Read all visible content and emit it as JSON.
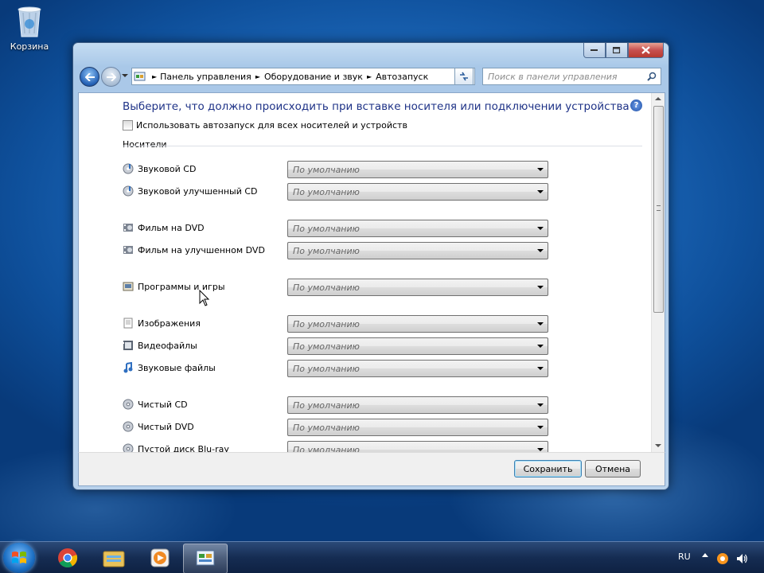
{
  "desktop": {
    "recycle_bin_label": "Корзина"
  },
  "window": {
    "breadcrumb": [
      "Панель управления",
      "Оборудование и звук",
      "Автозапуск"
    ],
    "search_placeholder": "Поиск в панели управления",
    "heading": "Выберите, что должно происходить при вставке носителя или подключении устройства",
    "use_autoplay_label": "Использовать автозапуск для всех носителей и устройств",
    "use_autoplay_checked": false,
    "media_group_label": "Носители",
    "rows": [
      {
        "label": "Звуковой CD",
        "value": "По умолчанию",
        "icon": "audio-cd-icon"
      },
      {
        "label": "Звуковой улучшенный CD",
        "value": "По умолчанию",
        "icon": "enhanced-audio-cd-icon"
      },
      {
        "label": "Фильм на DVD",
        "value": "По умолчанию",
        "icon": "dvd-movie-icon"
      },
      {
        "label": "Фильм на улучшенном DVD",
        "value": "По умолчанию",
        "icon": "enhanced-dvd-movie-icon"
      },
      {
        "label": "Программы и игры",
        "value": "По умолчанию",
        "icon": "software-games-icon"
      },
      {
        "label": "Изображения",
        "value": "По умолчанию",
        "icon": "pictures-icon"
      },
      {
        "label": "Видеофайлы",
        "value": "По умолчанию",
        "icon": "video-files-icon"
      },
      {
        "label": "Звуковые файлы",
        "value": "По умолчанию",
        "icon": "audio-files-icon"
      },
      {
        "label": "Чистый CD",
        "value": "По умолчанию",
        "icon": "blank-cd-icon"
      },
      {
        "label": "Чистый DVD",
        "value": "По умолчанию",
        "icon": "blank-dvd-icon"
      },
      {
        "label": "Пустой диск Blu-ray",
        "value": "По умолчанию",
        "icon": "blank-bluray-icon"
      }
    ],
    "save_label": "Сохранить",
    "cancel_label": "Отмена"
  },
  "taskbar": {
    "language": "RU"
  }
}
